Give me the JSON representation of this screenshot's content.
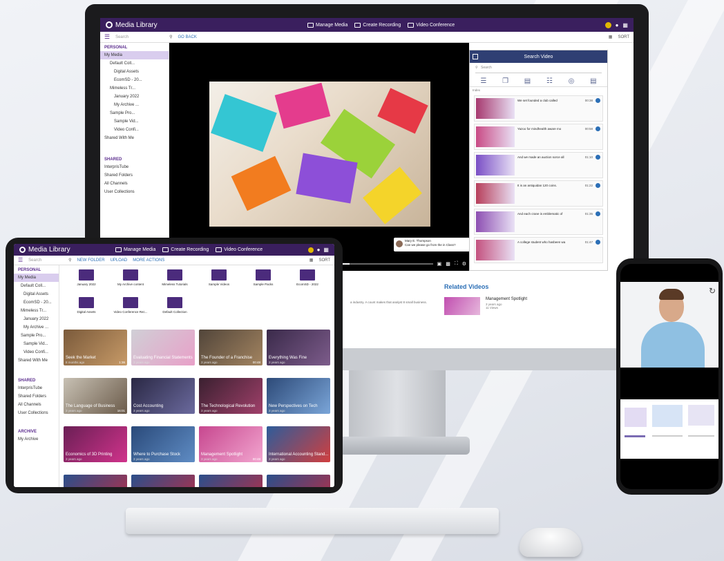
{
  "app": {
    "title": "Media Library",
    "nav": {
      "manage": "Manage Media",
      "record": "Create Recording",
      "conference": "Video Conference"
    },
    "search_placeholder": "Search",
    "go_back": "GO BACK",
    "sort": "SORT",
    "new_folder": "NEW FOLDER",
    "upload": "UPLOAD",
    "more_actions": "MORE ACTIONS"
  },
  "sidebar": {
    "personal": "PERSONAL",
    "items": [
      "My Media",
      "Default Coll...",
      "Digital Assets",
      "EcomSD - 20...",
      "Mimeless Tr...",
      "January 2022",
      "My Archive ...",
      "Sample Pro...",
      "Sample Vid...",
      "Video Confi...",
      "Shared With Me"
    ],
    "shared": "SHARED",
    "shared_items": [
      "InterprisTube",
      "Shared Folders",
      "All Channels",
      "User Collections"
    ],
    "archive": "ARCHIVE",
    "archive_items": [
      "My Archive"
    ]
  },
  "search_panel": {
    "title": "Search Video",
    "placeholder": "Search",
    "results_label": "Index",
    "results": [
      {
        "text": "We set founded a club called",
        "time": "00:38"
      },
      {
        "text": "Yazoo for mindhealth aware mo",
        "time": "00:58"
      },
      {
        "text": "And we made an auction sorce all",
        "time": "01:10"
      },
      {
        "text": "It is an antiquidan 120 coins.",
        "time": "01:22"
      },
      {
        "text": "And each crane is emblematic of",
        "time": "01:35"
      },
      {
        "text": "A college student who hasbeen wa",
        "time": "01:47"
      }
    ]
  },
  "comment": {
    "name": "Mary E. Thompson",
    "text": "Can we please go from the in Class?"
  },
  "related": {
    "title": "Related Videos",
    "desc": "a industry. A count makes that analyst 8 small business.",
    "item_title": "Management Spotlight",
    "item_age": "3 years ago",
    "item_views": "11 Views"
  },
  "tablet": {
    "folders": [
      "January 2022",
      "My Archive content",
      "Mimeless Tutorials",
      "Sample Videos",
      "Sample Packs",
      "EcomSD - 2022",
      "Digital Assets",
      "Video Conference Rec...",
      "Default Collection"
    ],
    "videos": [
      {
        "title": "Seek the Market",
        "age": "8 months ago",
        "dur": "1:36"
      },
      {
        "title": "Evaluating Financial Statements",
        "age": "3 years ago",
        "dur": ""
      },
      {
        "title": "The Founder of a Franchise",
        "age": "3 years ago",
        "dur": "00:48"
      },
      {
        "title": "Everything Was Fine",
        "age": "3 years ago",
        "dur": ""
      },
      {
        "title": "The Language of Business",
        "age": "3 years ago",
        "dur": "16:01"
      },
      {
        "title": "Cost Accounting",
        "age": "3 years ago",
        "dur": ""
      },
      {
        "title": "The Technological Revolution",
        "age": "3 years ago",
        "dur": ""
      },
      {
        "title": "New Perspectives on Tech",
        "age": "3 years ago",
        "dur": ""
      },
      {
        "title": "Economics of 3D Printing",
        "age": "3 years ago",
        "dur": ""
      },
      {
        "title": "Where to Purchase Stock",
        "age": "3 years ago",
        "dur": ""
      },
      {
        "title": "Management Spotlight",
        "age": "3 years ago",
        "dur": "00:48"
      },
      {
        "title": "International Accounting Stand...",
        "age": "3 years ago",
        "dur": ""
      }
    ]
  },
  "colors": {
    "brand": "#3a1f5e",
    "accent": "#5b2d8e",
    "link": "#2c6fb6"
  }
}
